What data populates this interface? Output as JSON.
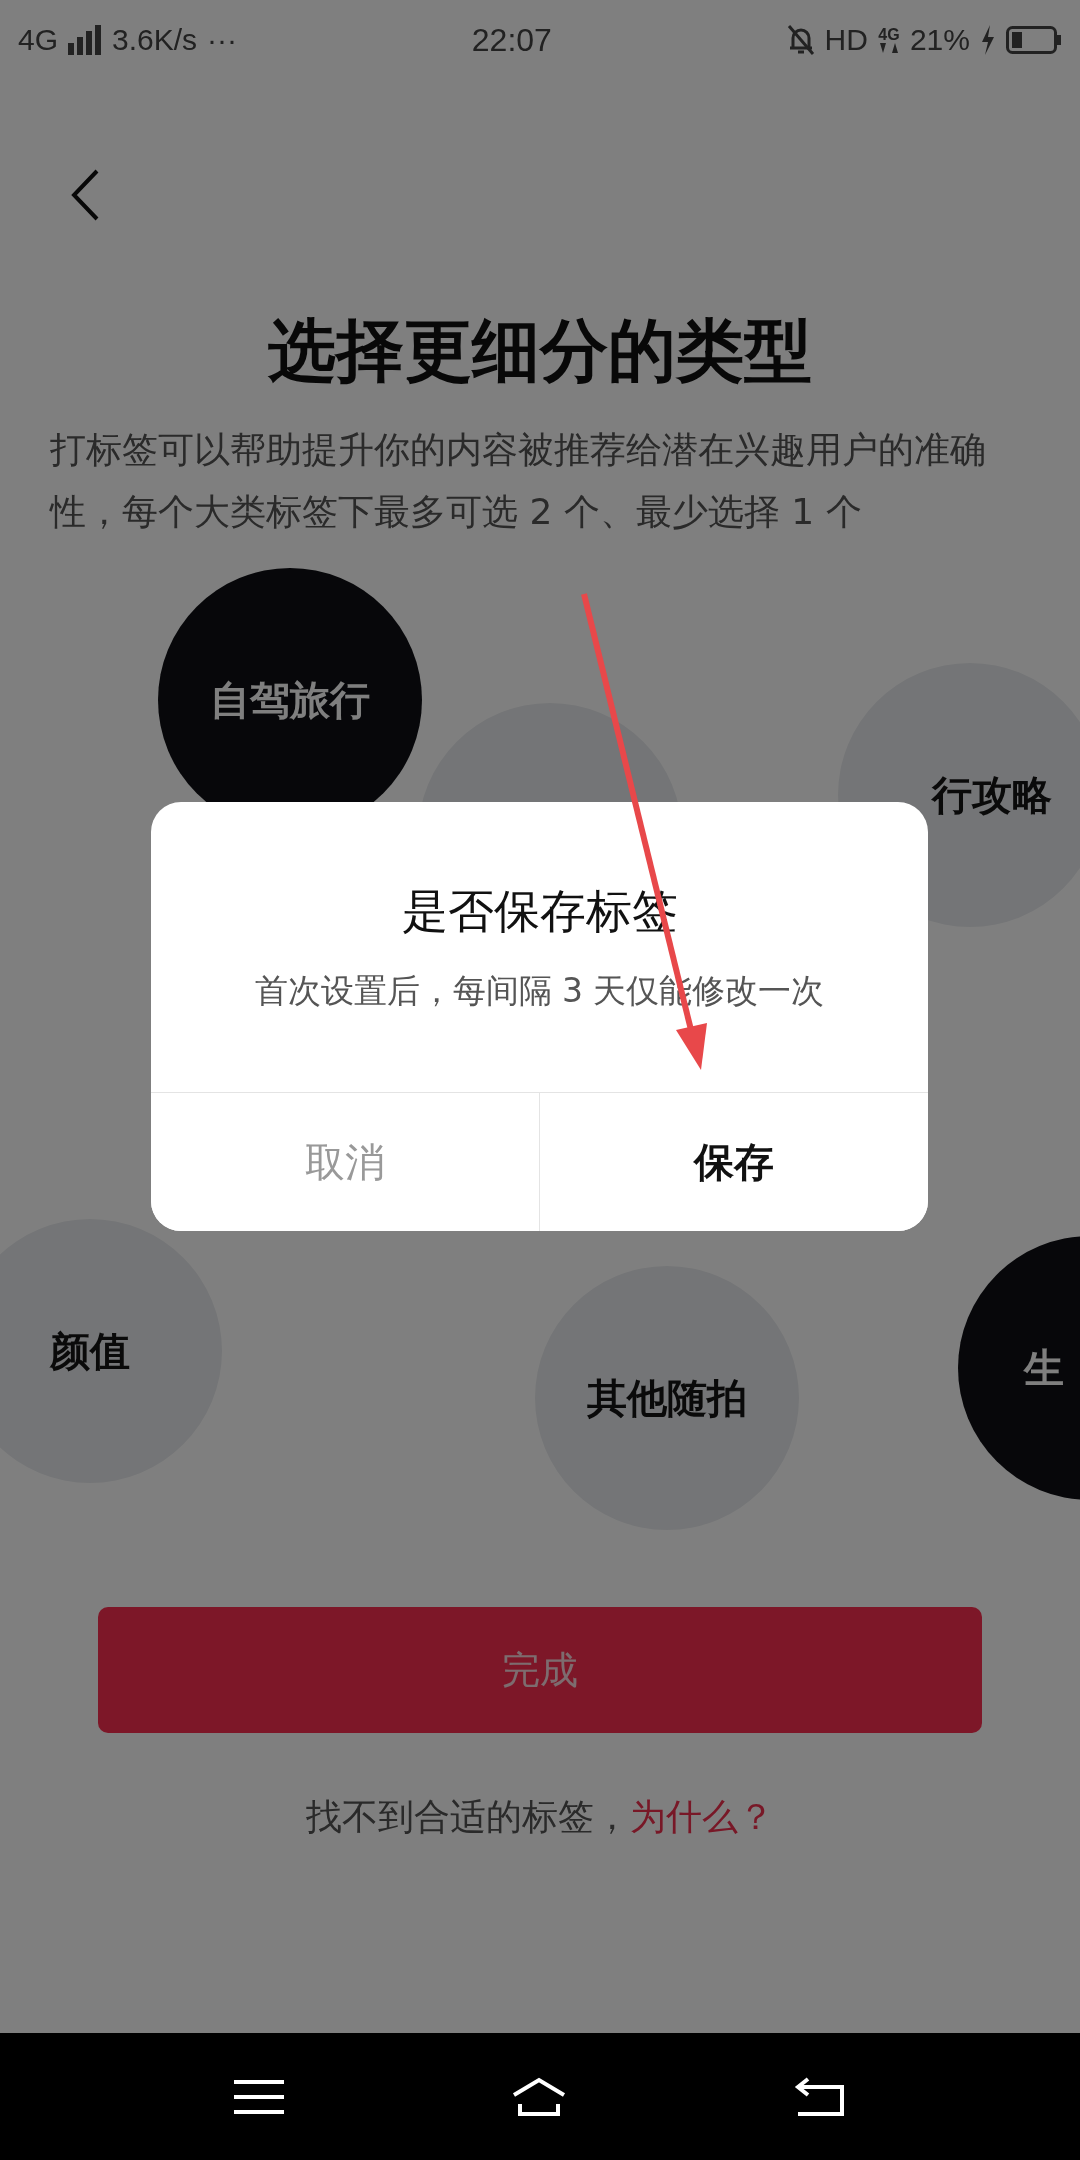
{
  "status_bar": {
    "network": "4G",
    "speed": "3.6K/s",
    "more": "···",
    "time": "22:07",
    "hd": "HD",
    "data_type": "4G",
    "battery": "21%"
  },
  "header": {
    "title": "选择更细分的类型",
    "description": "打标签可以帮助提升你的内容被推荐给潜在兴趣用户的准确性，每个大类标签下最多可选 2 个、最少选择 1 个"
  },
  "tags": [
    {
      "label": "自驾旅行",
      "selected": true
    },
    {
      "selected": false
    },
    {
      "label": "行攻略",
      "selected": false
    },
    {
      "label": "颜值",
      "selected": false
    },
    {
      "label": "其他随拍",
      "selected": false
    },
    {
      "label": "生",
      "selected": true
    }
  ],
  "done_button": "完成",
  "footer": {
    "text": "找不到合适的标签，",
    "link": "为什么？"
  },
  "dialog": {
    "title": "是否保存标签",
    "message": "首次设置后，每间隔 3 天仅能修改一次",
    "buttons": [
      {
        "label": "取消",
        "kind": "cancel"
      },
      {
        "label": "保存",
        "kind": "confirm"
      }
    ]
  }
}
